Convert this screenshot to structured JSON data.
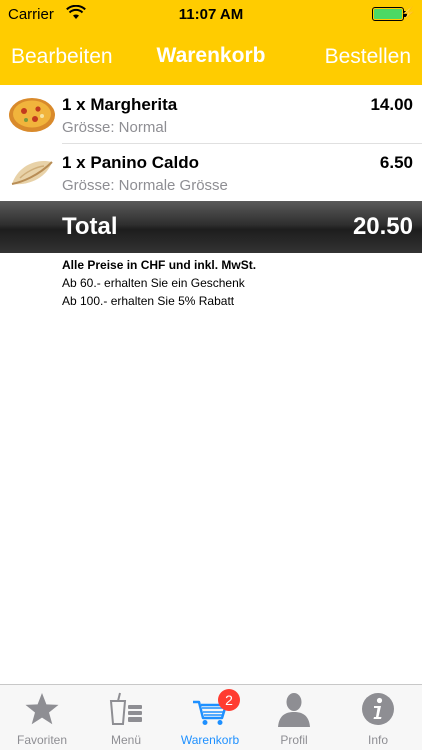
{
  "status_bar": {
    "carrier": "Carrier",
    "time": "11:07 AM",
    "battery_level": 1.0
  },
  "nav": {
    "left_label": "Bearbeiten",
    "title": "Warenkorb",
    "right_label": "Bestellen"
  },
  "cart": {
    "items": [
      {
        "name": "1 x Margherita",
        "size": "Grösse: Normal",
        "price": "14.00",
        "icon": "pizza-image"
      },
      {
        "name": "1 x Panino Caldo",
        "size": "Grösse: Normale Grösse",
        "price": "6.50",
        "icon": "panino-image"
      }
    ],
    "total_label": "Total",
    "total_amount": "20.50"
  },
  "notes": {
    "line1": "Alle Preise in CHF und inkl. MwSt.",
    "line2": "Ab 60.- erhalten Sie ein Geschenk",
    "line3": "Ab 100.- erhalten Sie 5% Rabatt"
  },
  "tabbar": {
    "tabs": [
      {
        "label": "Favoriten",
        "icon": "star-icon"
      },
      {
        "label": "Menü",
        "icon": "menu-icon"
      },
      {
        "label": "Warenkorb",
        "icon": "cart-icon",
        "badge": "2",
        "active": true
      },
      {
        "label": "Profil",
        "icon": "profile-icon"
      },
      {
        "label": "Info",
        "icon": "info-icon"
      }
    ]
  },
  "colors": {
    "accent": "#ffcc00",
    "active_tab": "#1e90ff",
    "badge": "#ff3b30"
  }
}
